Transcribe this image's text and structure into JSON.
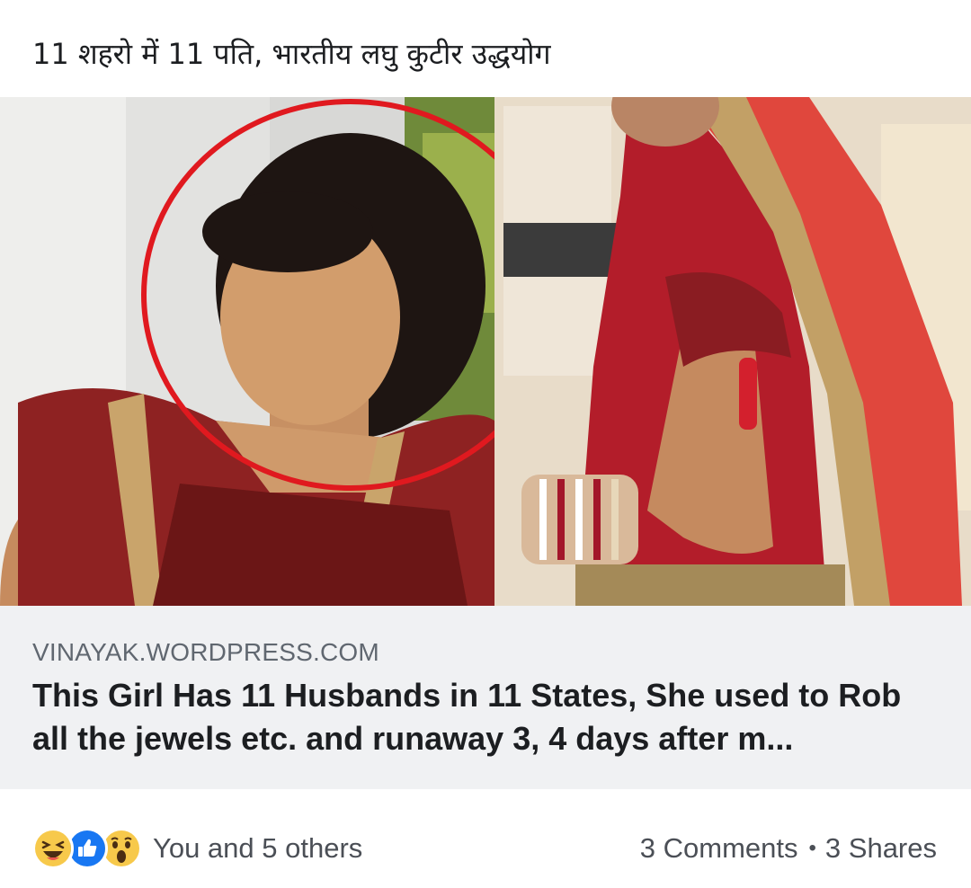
{
  "post": {
    "text": "11 शहरो में 11 पति, भारतीय लघु कुटीर उद्धयोग"
  },
  "link_preview": {
    "domain": "VINAYAK.WORDPRESS.COM",
    "title": "This Girl Has 11 Husbands in 11 States, She used to Rob all the jewels etc. and runaway 3, 4 days after m..."
  },
  "reactions": {
    "icons": [
      "laughing-icon",
      "like-icon",
      "wow-icon"
    ],
    "summary": "You and 5 others"
  },
  "counts": {
    "comments": "3 Comments",
    "separator": "•",
    "shares": "3 Shares"
  },
  "colors": {
    "like_blue": "#1877f2",
    "reaction_yellow": "#f7c94b",
    "highlight_circle": "#e0191f"
  }
}
